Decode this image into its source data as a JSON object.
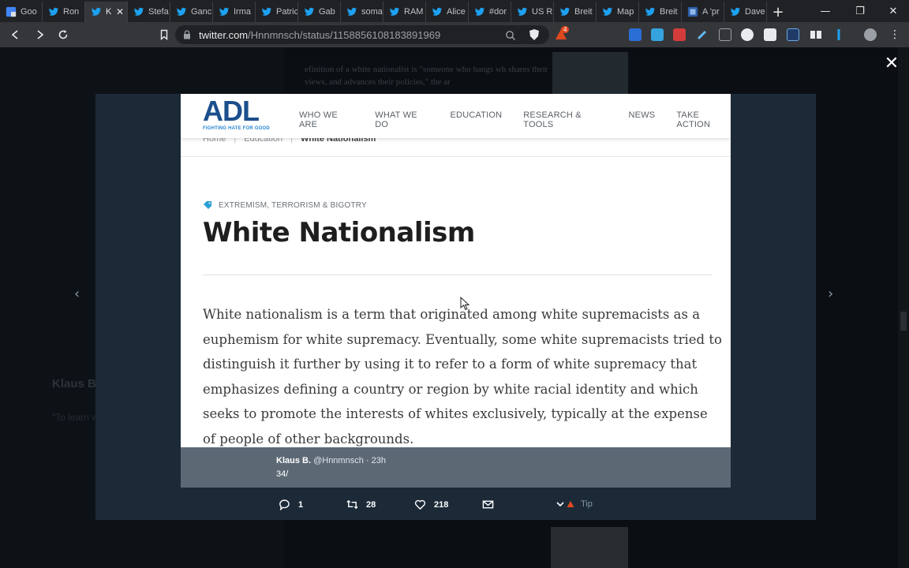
{
  "browser": {
    "tabs": [
      {
        "label": "Goo",
        "icon": "google-translate-icon",
        "active": false
      },
      {
        "label": "Ron",
        "icon": "twitter-bird-icon",
        "active": false
      },
      {
        "label": "K",
        "icon": "twitter-bird-icon",
        "active": true
      },
      {
        "label": "Stefa",
        "icon": "twitter-bird-icon",
        "active": false
      },
      {
        "label": "Ganc",
        "icon": "twitter-bird-icon",
        "active": false
      },
      {
        "label": "Irma",
        "icon": "twitter-bird-icon",
        "active": false
      },
      {
        "label": "Patric",
        "icon": "twitter-bird-icon",
        "active": false
      },
      {
        "label": "Gab",
        "icon": "twitter-bird-icon",
        "active": false
      },
      {
        "label": "soma",
        "icon": "twitter-bird-icon",
        "active": false
      },
      {
        "label": "RAM",
        "icon": "twitter-bird-icon",
        "active": false
      },
      {
        "label": "Alice",
        "icon": "twitter-bird-icon",
        "active": false
      },
      {
        "label": "#dor",
        "icon": "twitter-bird-icon",
        "active": false
      },
      {
        "label": "US R",
        "icon": "twitter-bird-icon",
        "active": false
      },
      {
        "label": "Breit",
        "icon": "twitter-bird-icon",
        "active": false
      },
      {
        "label": "Map",
        "icon": "twitter-bird-icon",
        "active": false
      },
      {
        "label": "Breit",
        "icon": "twitter-bird-icon",
        "active": false
      },
      {
        "label": "A 'pr",
        "icon": "site-favicon-icon",
        "active": false
      },
      {
        "label": "Dave",
        "icon": "twitter-bird-icon",
        "active": false
      }
    ],
    "new_tab": "+",
    "url_host": "twitter.com",
    "url_path": "/Hnnmnsch/status/1158856108183891969",
    "brave_badge": "4"
  },
  "backdrop": {
    "tweet_text": "efinition of a white nationalist is \"someone who hangs wh shares their views, and advances their policies,\" the ar",
    "author_name": "Klaus B",
    "quote_preview": "\"To learn w who you a"
  },
  "adl": {
    "logo": "ADL",
    "logo_tagline": "FIGHTING HATE FOR GOOD",
    "menu": [
      "WHO WE ARE",
      "WHAT WE DO",
      "EDUCATION",
      "RESEARCH & TOOLS",
      "NEWS",
      "TAKE ACTION"
    ],
    "breadcrumbs": [
      "Home",
      "Education",
      "White Nationalism"
    ],
    "category": "EXTREMISM, TERRORISM & BIGOTRY",
    "title": "White Nationalism",
    "body": "White nationalism is a term that originated among white supremacists as a euphemism for white supremacy. Eventually, some white supremacists tried to distinguish it further by using it to refer to a form of white supremacy that emphasizes defining a country or region by white racial identity and which seeks to promote the interests of whites exclusively, typically at the expense of people of other backgrounds."
  },
  "tweet": {
    "author": "Klaus B.",
    "handle": "@Hnnmnsch",
    "time": "· 23h",
    "text": "34/",
    "replies": "1",
    "retweets": "28",
    "likes": "218",
    "tip_label": "Tip"
  },
  "colors": {
    "twitter_blue": "#1da1f2",
    "adl_blue": "#1b4f8c",
    "adl_light_blue": "#2a87d0"
  }
}
